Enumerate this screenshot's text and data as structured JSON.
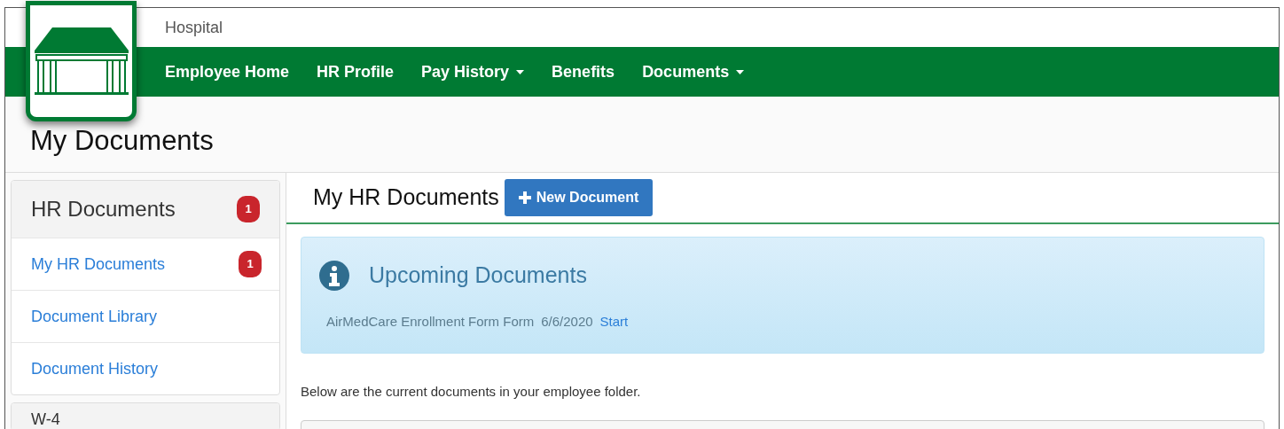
{
  "header": {
    "org_name": "Hospital"
  },
  "nav": [
    {
      "label": "Employee Home",
      "dropdown": false
    },
    {
      "label": "HR Profile",
      "dropdown": false
    },
    {
      "label": "Pay History",
      "dropdown": true
    },
    {
      "label": "Benefits",
      "dropdown": false
    },
    {
      "label": "Documents",
      "dropdown": true
    }
  ],
  "page_title": "My Documents",
  "sidebar": {
    "panels": [
      {
        "title": "HR Documents",
        "badge": "1",
        "items": [
          {
            "label": "My HR Documents",
            "badge": "1"
          },
          {
            "label": "Document Library"
          },
          {
            "label": "Document History"
          }
        ]
      },
      {
        "title": "W-4"
      }
    ]
  },
  "main": {
    "title": "My HR Documents",
    "new_button": "New Document",
    "alert": {
      "title": "Upcoming Documents",
      "items": [
        {
          "name": "AirMedCare Enrollment Form Form",
          "date": "6/6/2020",
          "action": "Start"
        }
      ]
    },
    "description": "Below are the current documents in your employee folder."
  }
}
